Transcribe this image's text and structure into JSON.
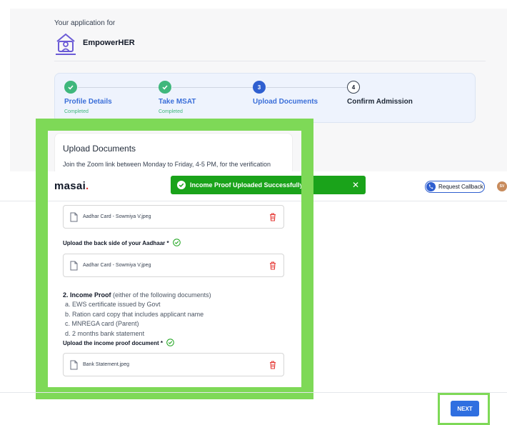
{
  "header": {
    "application_for": "Your application for",
    "program_name": "EmpowerHER"
  },
  "stepper": {
    "steps": [
      {
        "number": "1",
        "label": "Profile Details",
        "status": "Completed",
        "state": "done"
      },
      {
        "number": "2",
        "label": "Take MSAT",
        "status": "Completed",
        "state": "done"
      },
      {
        "number": "3",
        "label": "Upload Documents",
        "status": "",
        "state": "active"
      },
      {
        "number": "4",
        "label": "Confirm Admission",
        "status": "",
        "state": "todo"
      }
    ]
  },
  "upload": {
    "title": "Upload Documents",
    "intro": "Join the Zoom link between Monday to Friday, 4-5 PM, for the verification"
  },
  "navbar": {
    "logo": "masai",
    "logo_dot": ".",
    "toast": "Income Proof Uploaded Successfully",
    "toast_close": "✕",
    "callback_label": "Request Callback",
    "avatar_initials": "SV"
  },
  "files": {
    "aadhaar_front": "Aadhar Card - Sowmiya V.jpeg",
    "aadhaar_back_label": "Upload the back side of your Aadhaar *",
    "aadhaar_back": "Aadhar Card - Sowmiya V.jpeg",
    "income_label": "Upload the income proof document *",
    "income_file": "Bank Statement.jpeg"
  },
  "income_proof": {
    "number": "2. ",
    "title": "Income Proof",
    "subtitle": " (either of the following documents)",
    "items": [
      "a. EWS certificate issued by Govt",
      "b. Ration card copy that includes applicant name",
      "c. MNREGA card (Parent)",
      "d. 2 months bank statement"
    ]
  },
  "footer": {
    "next_label": "NEXT"
  },
  "colors": {
    "primary": "#2f5fd0",
    "success": "#3fb77c",
    "toast": "#1aa31a",
    "highlight": "#7ed957",
    "danger": "#e53935"
  }
}
